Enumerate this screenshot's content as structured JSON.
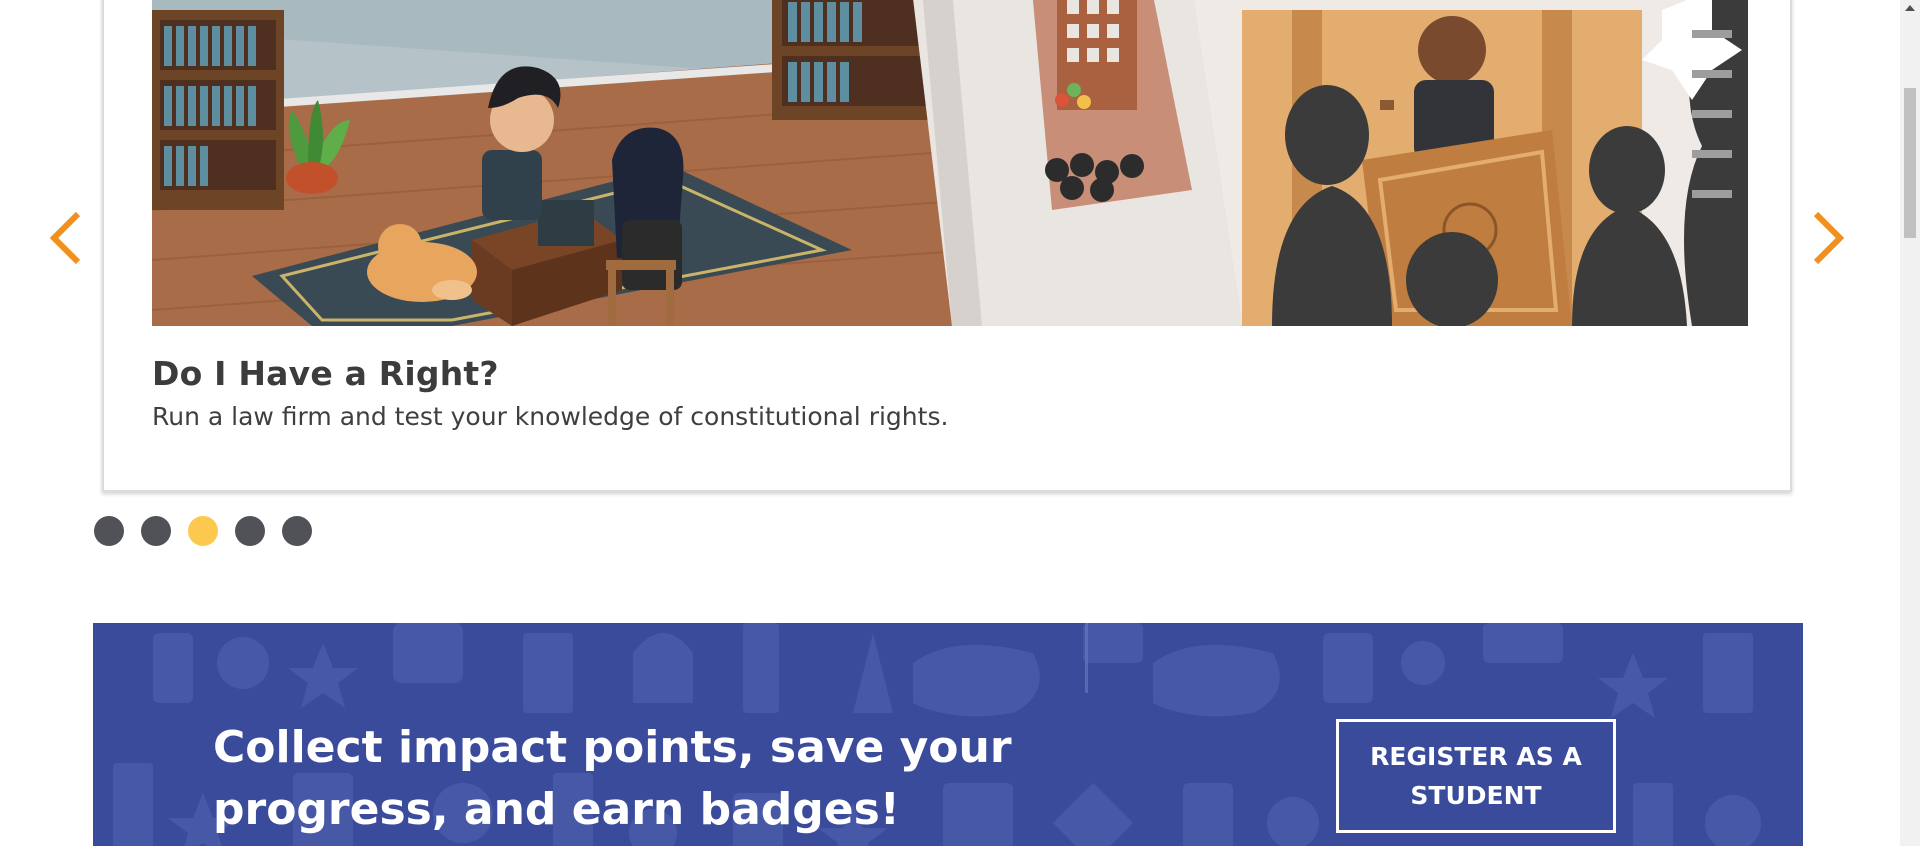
{
  "carousel": {
    "prev_icon": "chevron-left-icon",
    "next_icon": "chevron-right-icon",
    "arrow_color": "#f0901e",
    "slide": {
      "title": "Do I Have a Right?",
      "description": "Run a law firm and test your knowledge of constitutional rights."
    },
    "dots": [
      {
        "state": "inactive",
        "color": "#505257"
      },
      {
        "state": "inactive",
        "color": "#505257"
      },
      {
        "state": "active",
        "color": "#fcc94e"
      },
      {
        "state": "inactive",
        "color": "#505257"
      },
      {
        "state": "inactive",
        "color": "#505257"
      }
    ]
  },
  "banner": {
    "background": "#3a4b9c",
    "text": "Collect impact points, save your progress, and earn badges!",
    "button_label": "REGISTER AS A STUDENT"
  },
  "scrollbar": {
    "up_icon": "scroll-up-arrow-icon"
  }
}
